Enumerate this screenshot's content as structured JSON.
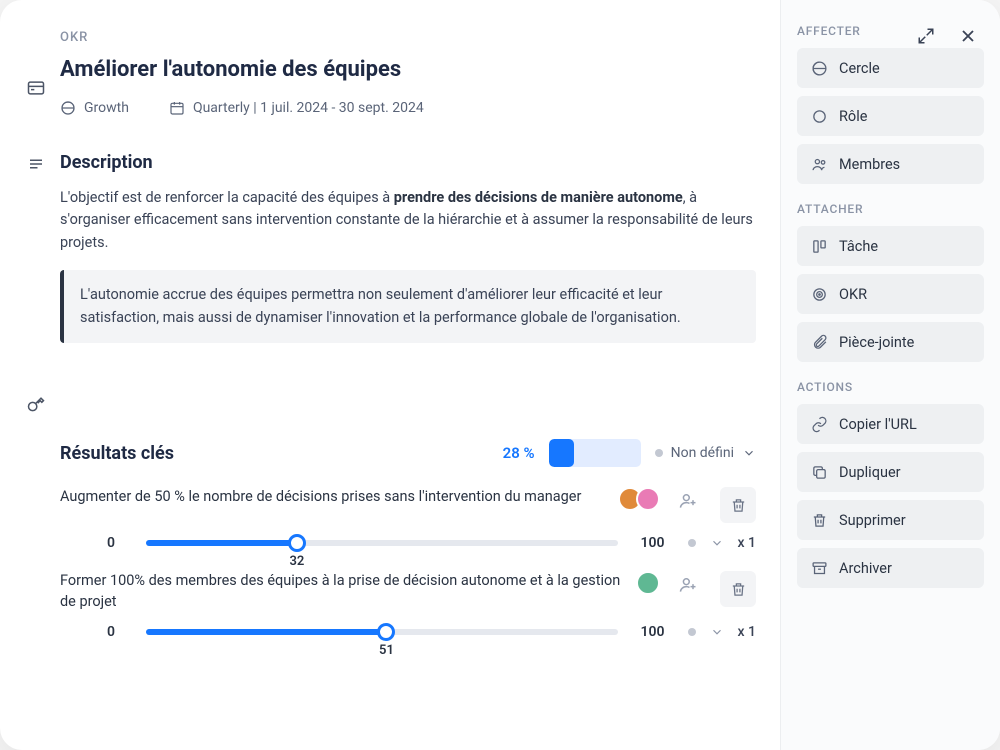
{
  "header": {
    "kicker": "OKR",
    "title": "Améliorer l'autonomie des équipes",
    "circle": "Growth",
    "period": "Quarterly | 1 juil. 2024 - 30 sept. 2024"
  },
  "description": {
    "heading": "Description",
    "body_pre": "L'objectif est de renforcer la capacité des équipes à ",
    "body_bold": "prendre des décisions de manière autonome",
    "body_post": ", à s'organiser efficacement sans intervention constante de la hiérarchie et à assumer la responsabilité de leurs projets.",
    "highlight": "L'autonomie accrue des équipes permettra non seulement d'améliorer leur efficacité et leur satisfaction, mais aussi de dynamiser l'innovation et la performance globale de l'organisation."
  },
  "results": {
    "heading": "Résultats clés",
    "percent_label": "28 %",
    "percent": 28,
    "status": "Non défini",
    "items": [
      {
        "label": "Augmenter de 50 % le nombre de décisions prises sans l'intervention du manager",
        "min": "0",
        "max": "100",
        "value": "32",
        "value_pct": 32,
        "multiplier": "x 1",
        "avatars": [
          "#e08a3a",
          "#e97bb5"
        ]
      },
      {
        "label": "Former 100% des membres des équipes à la prise de décision autonome et à la gestion de projet",
        "min": "0",
        "max": "100",
        "value": "51",
        "value_pct": 51,
        "multiplier": "x 1",
        "avatars": [
          "#5fb893"
        ]
      }
    ]
  },
  "sidebar": {
    "affecter_label": "AFFECTER",
    "affecter": [
      {
        "icon": "circle-group",
        "label": "Cercle"
      },
      {
        "icon": "ring",
        "label": "Rôle"
      },
      {
        "icon": "members",
        "label": "Membres"
      }
    ],
    "attacher_label": "ATTACHER",
    "attacher": [
      {
        "icon": "task",
        "label": "Tâche"
      },
      {
        "icon": "okr",
        "label": "OKR"
      },
      {
        "icon": "clip",
        "label": "Pièce-jointe"
      }
    ],
    "actions_label": "ACTIONS",
    "actions": [
      {
        "icon": "link",
        "label": "Copier l'URL"
      },
      {
        "icon": "duplicate",
        "label": "Dupliquer"
      },
      {
        "icon": "trash",
        "label": "Supprimer"
      },
      {
        "icon": "archive",
        "label": "Archiver"
      }
    ]
  }
}
